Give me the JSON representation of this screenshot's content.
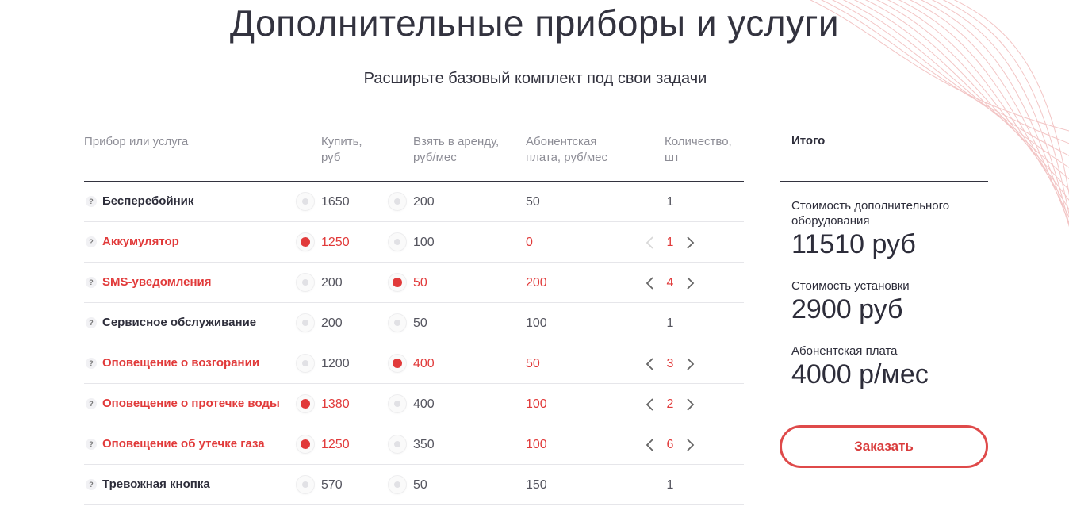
{
  "header": {
    "title": "Дополнительные приборы и услуги",
    "subtitle": "Расширьте базовый комплект под свои задачи"
  },
  "table": {
    "columns": {
      "item": "Прибор или услуга",
      "buy_line1": "Купить,",
      "buy_line2": "руб",
      "rent_line1": "Взять в аренду,",
      "rent_line2": "руб/мес",
      "fee_line1": "Абонентская",
      "fee_line2": "плата, руб/мес",
      "qty_line1": "Количество,",
      "qty_line2": "шт"
    },
    "help_glyph": "?",
    "rows": [
      {
        "name": "Бесперебойник",
        "buy": "1650",
        "rent": "200",
        "fee": "50",
        "qty": "1",
        "selected": "none"
      },
      {
        "name": "Аккумулятор",
        "buy": "1250",
        "rent": "100",
        "fee": "0",
        "qty": "1",
        "selected": "buy"
      },
      {
        "name": "SMS-уведомления",
        "buy": "200",
        "rent": "50",
        "fee": "200",
        "qty": "4",
        "selected": "rent"
      },
      {
        "name": "Сервисное обслуживание",
        "buy": "200",
        "rent": "50",
        "fee": "100",
        "qty": "1",
        "selected": "none"
      },
      {
        "name": "Оповещение о возгорании",
        "buy": "1200",
        "rent": "400",
        "fee": "50",
        "qty": "3",
        "selected": "rent"
      },
      {
        "name": "Оповещение о протечке воды",
        "buy": "1380",
        "rent": "400",
        "fee": "100",
        "qty": "2",
        "selected": "buy"
      },
      {
        "name": "Оповещение об утечке газа",
        "buy": "1250",
        "rent": "350",
        "fee": "100",
        "qty": "6",
        "selected": "buy"
      },
      {
        "name": "Тревожная кнопка",
        "buy": "570",
        "rent": "50",
        "fee": "150",
        "qty": "1",
        "selected": "none"
      }
    ]
  },
  "summary": {
    "heading": "Итого",
    "equipment_label": "Стоимость дополнительного оборудования",
    "equipment_value": "11510 руб",
    "install_label": "Стоимость установки",
    "install_value": "2900 руб",
    "fee_label": "Абонентская плата",
    "fee_value": "4000 р/мес",
    "order_button": "Заказать"
  },
  "colors": {
    "accent": "#e13a3a",
    "text": "#2d2d3a",
    "muted": "#8d8d96",
    "decor_lines": "#f0b7b7"
  }
}
